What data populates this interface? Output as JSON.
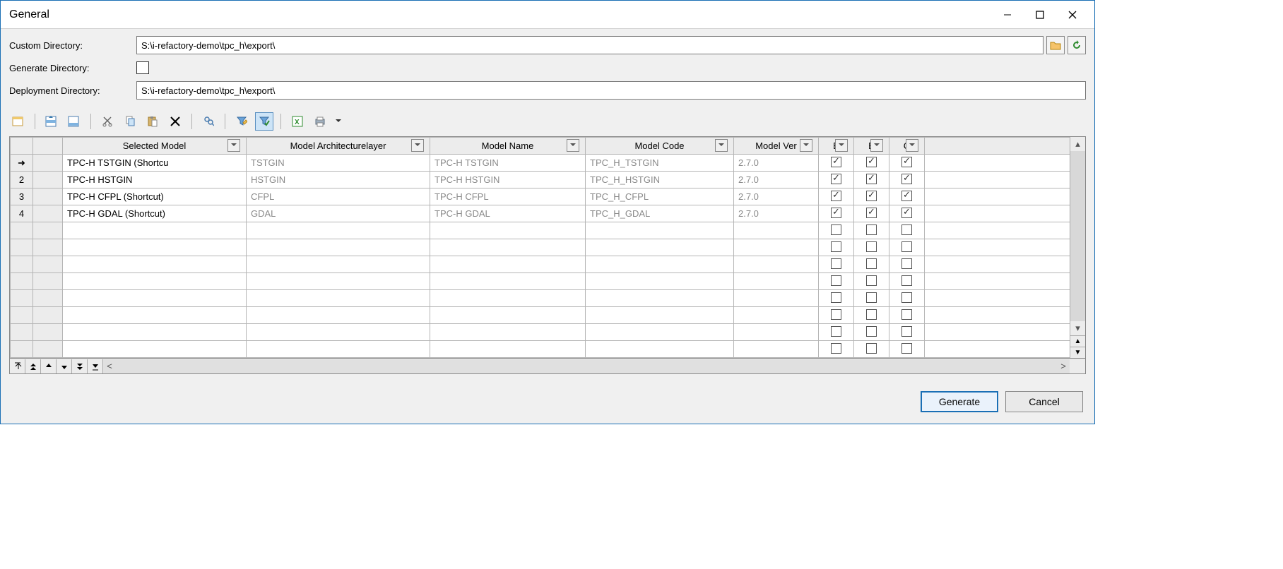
{
  "window": {
    "title": "General"
  },
  "form": {
    "custom_directory_label": "Custom Directory:",
    "custom_directory_value": "S:\\i-refactory-demo\\tpc_h\\export\\",
    "generate_directory_label": "Generate Directory:",
    "generate_directory_checked": false,
    "deployment_directory_label": "Deployment Directory:",
    "deployment_directory_value": "S:\\i-refactory-demo\\tpc_h\\export\\"
  },
  "toolbar_icons": {
    "properties": "properties-icon",
    "insert_row": "insert-row-icon",
    "add_row": "add-row-icon",
    "cut": "cut-icon",
    "copy": "copy-icon",
    "paste": "paste-icon",
    "delete": "delete-icon",
    "find": "find-icon",
    "filter_edit": "filter-edit-icon",
    "filter_apply": "filter-apply-icon",
    "excel": "excel-icon",
    "print": "print-icon"
  },
  "grid": {
    "columns": {
      "selected_model": "Selected Model",
      "architecture_layer": "Model Architecturelayer",
      "model_name": "Model Name",
      "model_code": "Model Code",
      "model_ver": "Model Ver",
      "e1": "E",
      "e2": "E",
      "c": "C"
    },
    "rows": [
      {
        "rownum": "➜",
        "selected_model": "TPC-H TSTGIN (Shortcu",
        "arch": "TSTGIN",
        "name": "TPC-H TSTGIN",
        "code": "TPC_H_TSTGIN",
        "ver": "2.7.0",
        "e1": true,
        "e2": true,
        "c": true
      },
      {
        "rownum": "2",
        "selected_model": "TPC-H HSTGIN",
        "arch": "HSTGIN",
        "name": "TPC-H HSTGIN",
        "code": "TPC_H_HSTGIN",
        "ver": "2.7.0",
        "e1": true,
        "e2": true,
        "c": true
      },
      {
        "rownum": "3",
        "selected_model": "TPC-H CFPL (Shortcut)",
        "arch": "CFPL",
        "name": "TPC-H CFPL",
        "code": "TPC_H_CFPL",
        "ver": "2.7.0",
        "e1": true,
        "e2": true,
        "c": true
      },
      {
        "rownum": "4",
        "selected_model": "TPC-H GDAL (Shortcut)",
        "arch": "GDAL",
        "name": "TPC-H GDAL",
        "code": "TPC_H_GDAL",
        "ver": "2.7.0",
        "e1": true,
        "e2": true,
        "c": true
      }
    ],
    "empty_rows": 8
  },
  "footer": {
    "generate": "Generate",
    "cancel": "Cancel"
  }
}
